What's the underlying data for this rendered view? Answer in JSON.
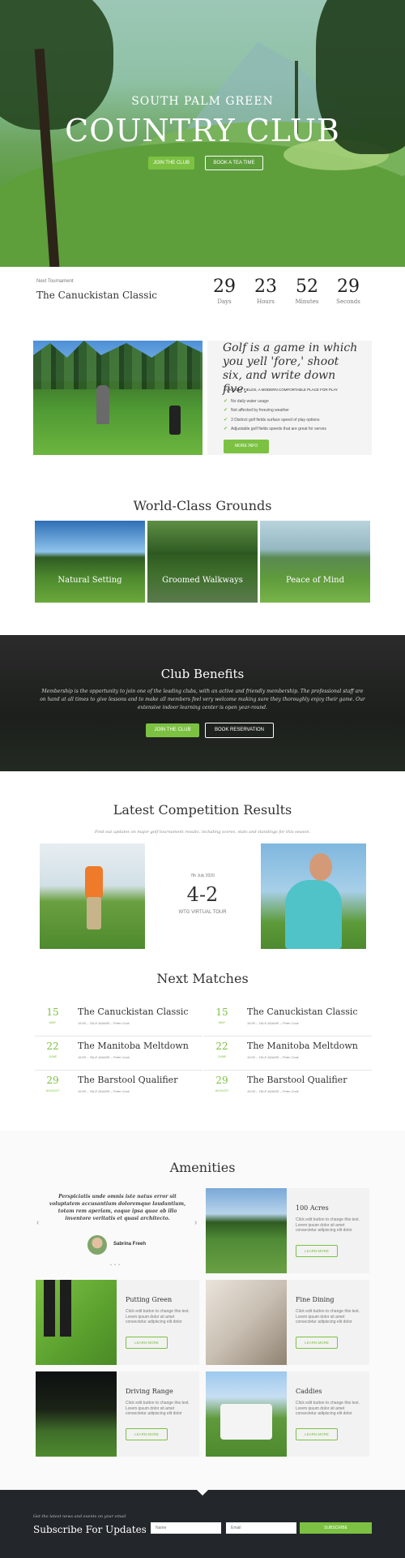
{
  "hero": {
    "subtitle": "SOUTH PALM GREEN",
    "title": "COUNTRY CLUB",
    "join_label": "JOIN THE CLUB",
    "book_label": "BOOK A TEA TIME"
  },
  "countdown": {
    "label": "Next Tournament",
    "event": "The Canuckistan Classic",
    "units": [
      {
        "value": "29",
        "label": "Days"
      },
      {
        "value": "23",
        "label": "Hours"
      },
      {
        "value": "52",
        "label": "Minutes"
      },
      {
        "value": "29",
        "label": "Seconds"
      }
    ]
  },
  "intro": {
    "title": "Golf is a game in which you yell 'fore,' shoot six, and write down five.",
    "caption": "OUR GOLF FIELDS, A MODERN COMFORTABLE PLACE FOR PLAY",
    "checks": [
      "No daily water usage",
      "Not affected by freezing weather",
      "3 Distinct golf fields surface speed of play options",
      "Adjustable golf fields speeds that are great for serves"
    ],
    "button": "MORE INFO"
  },
  "grounds": {
    "title": "World-Class Grounds",
    "items": [
      "Natural Setting",
      "Groomed Walkways",
      "Peace of Mind"
    ]
  },
  "benefits": {
    "title": "Club Benefits",
    "text": "Membership is the opportunity to join one of the leading clubs, with an active and friendly membership. The professional staff are on hand at all times to give lessons and to make all members feel very welcome making sure they thoroughly enjoy their game. Our extensive indoor learning center is open year-round.",
    "join_label": "JOIN THE CLUB",
    "book_label": "BOOK RESERVATION"
  },
  "results": {
    "title": "Latest Competition Results",
    "subtitle": "Find out updates on major golf tournament results, including scores, stats and standings for this season.",
    "date": "7th July 2020",
    "score": "4-2",
    "tour": "WTG VIRTUAL TOUR"
  },
  "matches": {
    "title": "Next Matches",
    "items": [
      {
        "day": "15",
        "month": "MAY",
        "name": "The Canuckistan Classic",
        "meta": "16:00 – TALE ADAMS – Peter Cook"
      },
      {
        "day": "15",
        "month": "MAY",
        "name": "The Canuckistan Classic",
        "meta": "16:00 – TALE ADAMS – Peter Cook"
      },
      {
        "day": "22",
        "month": "JUNE",
        "name": "The Manitoba Meltdown",
        "meta": "16:00 – TALE ADAMS – Peter Cook"
      },
      {
        "day": "22",
        "month": "JUNE",
        "name": "The Manitoba Meltdown",
        "meta": "16:00 – TALE ADAMS – Peter Cook"
      },
      {
        "day": "29",
        "month": "AUGUST",
        "name": "The Barstool Qualifier",
        "meta": "16:00 – TALE ADAMS – Peter Cook"
      },
      {
        "day": "29",
        "month": "AUGUST",
        "name": "The Barstool Qualifier",
        "meta": "16:00 – TALE ADAMS – Peter Cook"
      }
    ]
  },
  "amenities": {
    "title": "Amenities",
    "quote": "Perspiciatis unde omnis iste natus error sit voluptatem accusantium doloremque laudantium, totam rem aperiam, eaque ipsa quae ab illo inventore veritatis et quasi architecto.",
    "author": "Sabrina Freeh",
    "prev": "‹",
    "next": "›",
    "dots": "• • •",
    "cards": [
      {
        "title": "100 Acres",
        "desc": "Click edit button to change this text. Lorem ipsum dolor sit amet consectetur adipiscing elit dolor",
        "button": "LEARN MORE"
      },
      {
        "title": "Putting Green",
        "desc": "Click edit button to change this text. Lorem ipsum dolor sit amet consectetur adipiscing elit dolor",
        "button": "LEARN MORE"
      },
      {
        "title": "Fine Dining",
        "desc": "Click edit button to change this text. Lorem ipsum dolor sit amet consectetur adipiscing elit dolor",
        "button": "LEARN MORE"
      },
      {
        "title": "Driving Range",
        "desc": "Click edit button to change this text. Lorem ipsum dolor sit amet consectetur adipiscing elit dolor",
        "button": "LEARN MORE"
      },
      {
        "title": "Caddies",
        "desc": "Click edit button to change this text. Lorem ipsum dolor sit amet consectetur adipiscing elit dolor",
        "button": "LEARN MORE"
      }
    ]
  },
  "footer": {
    "small": "Get the latest news and events on your email",
    "title": "Subscribe For Updates",
    "name_placeholder": "Name",
    "email_placeholder": "Email",
    "button": "SUBSCRIBE"
  },
  "colors": {
    "accent": "#7cc142",
    "dark": "#23272b"
  }
}
